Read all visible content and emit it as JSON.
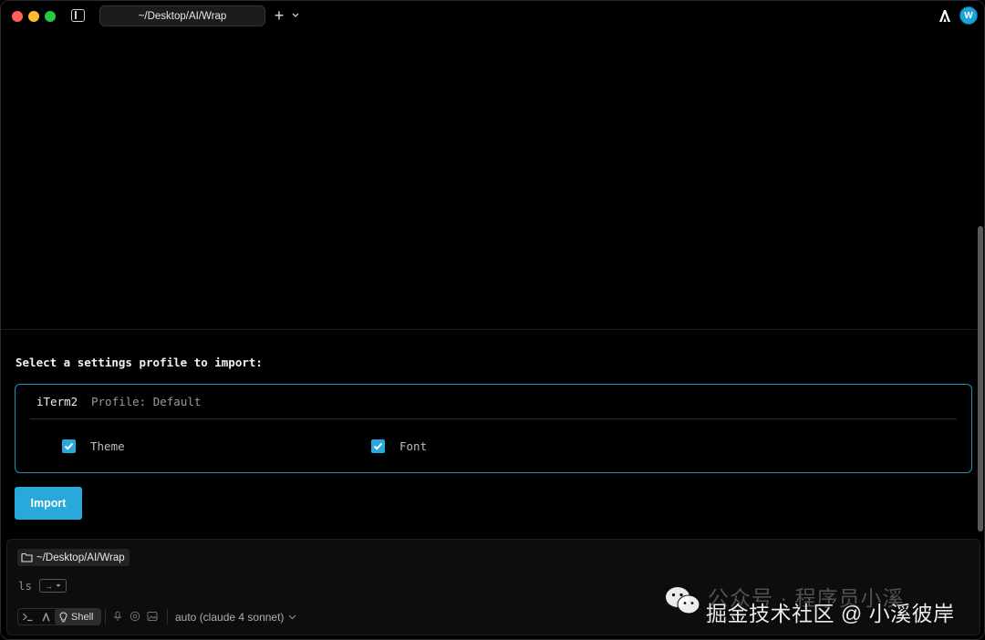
{
  "titlebar": {
    "tab_title": "~/Desktop/AI/Wrap",
    "avatar_letter": "W"
  },
  "import_dialog": {
    "title": "Select a settings profile to import:",
    "profile_source": "iTerm2",
    "profile_label": "Profile: Default",
    "options": [
      {
        "label": "Theme",
        "checked": true
      },
      {
        "label": "Font",
        "checked": true
      }
    ],
    "import_button": "Import"
  },
  "input_panel": {
    "directory": "~/Desktop/AI/Wrap",
    "command_text": "ls",
    "key_hint": "→",
    "mode_label": "Shell",
    "model": "auto (claude 4 sonnet)"
  },
  "watermark": {
    "top_line": "公众号 · 程序员小溪",
    "main_line": "掘金技术社区 @ 小溪彼岸"
  },
  "colors": {
    "accent": "#29a8dc",
    "background": "#000000",
    "avatar": "#1aa3d9"
  }
}
